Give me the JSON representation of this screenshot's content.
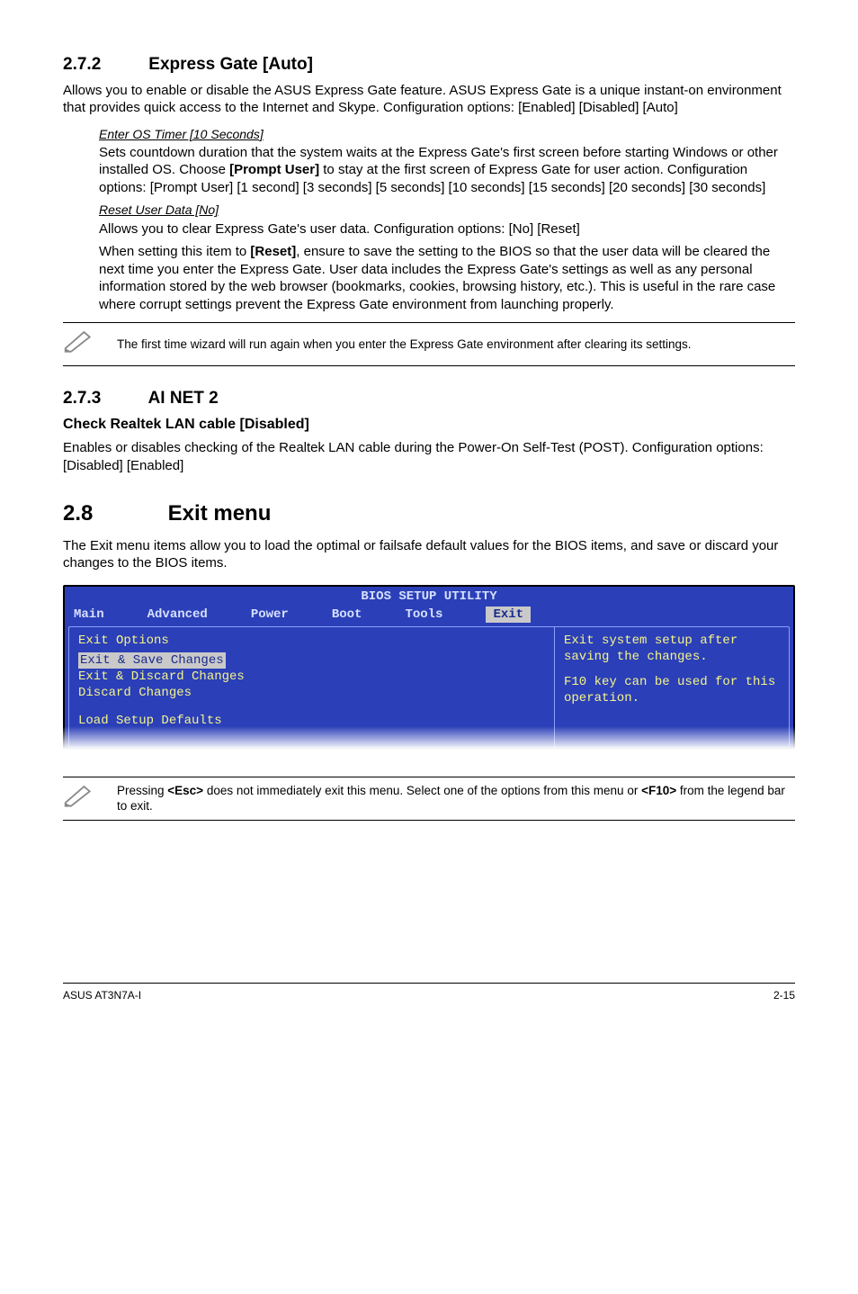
{
  "s272": {
    "heading_num": "2.7.2",
    "heading_title": "Express Gate [Auto]",
    "intro": "Allows you to enable or disable the ASUS Express Gate feature. ASUS Express Gate is a unique instant-on environment that provides quick access to the Internet and Skype. Configuration options: [Enabled] [Disabled] [Auto]",
    "sub1_head": "Enter OS Timer [10 Seconds]",
    "sub1_body_a": "Sets countdown duration that the system waits at the Express Gate's first screen before starting Windows or other installed OS. Choose ",
    "sub1_bold": "[Prompt User]",
    "sub1_body_b": " to stay at the first screen of Express Gate for user action. Configuration options: [Prompt User] [1 second] [3 seconds] [5 seconds] [10 seconds] [15 seconds] [20 seconds] [30 seconds]",
    "sub2_head": "Reset User Data [No]",
    "sub2_body1": "Allows you to clear Express Gate's user data. Configuration options: [No] [Reset]",
    "sub2_body2_a": "When setting this item to ",
    "sub2_bold": "[Reset]",
    "sub2_body2_b": ", ensure to save the setting to the BIOS so that the user data will be cleared the next time you enter the Express Gate. User data includes the Express Gate's settings as well as any personal information stored by the web browser (bookmarks, cookies, browsing history, etc.). This is useful in the rare case where corrupt settings prevent the Express Gate environment from launching properly.",
    "note": "The first time wizard will run again when you enter the Express Gate environment after clearing its settings."
  },
  "s273": {
    "heading_num": "2.7.3",
    "heading_title": "AI NET 2",
    "subhead": "Check Realtek LAN cable [Disabled]",
    "body": "Enables or disables checking of the Realtek LAN cable during the Power-On Self-Test (POST). Configuration options: [Disabled] [Enabled]"
  },
  "s28": {
    "heading_num": "2.8",
    "heading_title": "Exit menu",
    "intro": "The Exit menu items allow you to load the optimal or failsafe default values for the BIOS items, and save or discard your changes to the BIOS items."
  },
  "bios": {
    "title": "BIOS SETUP UTILITY",
    "tabs": {
      "t1": "Main",
      "t2": "Advanced",
      "t3": "Power",
      "t4": "Boot",
      "t5": "Tools",
      "t6": "Exit"
    },
    "left_head": "Exit Options",
    "opt1": "Exit & Save Changes",
    "opt2": "Exit & Discard Changes",
    "opt3": "Discard Changes",
    "opt4": "Load Setup Defaults",
    "right1": "Exit system setup after saving the changes.",
    "right2": "F10 key can be used for this operation."
  },
  "note2_a": "Pressing ",
  "note2_b1": "<Esc>",
  "note2_c": " does not immediately exit this menu. Select one of the options from this menu or ",
  "note2_b2": "<F10>",
  "note2_d": " from the legend bar to exit.",
  "footer": {
    "left": "ASUS AT3N7A-I",
    "right": "2-15"
  }
}
